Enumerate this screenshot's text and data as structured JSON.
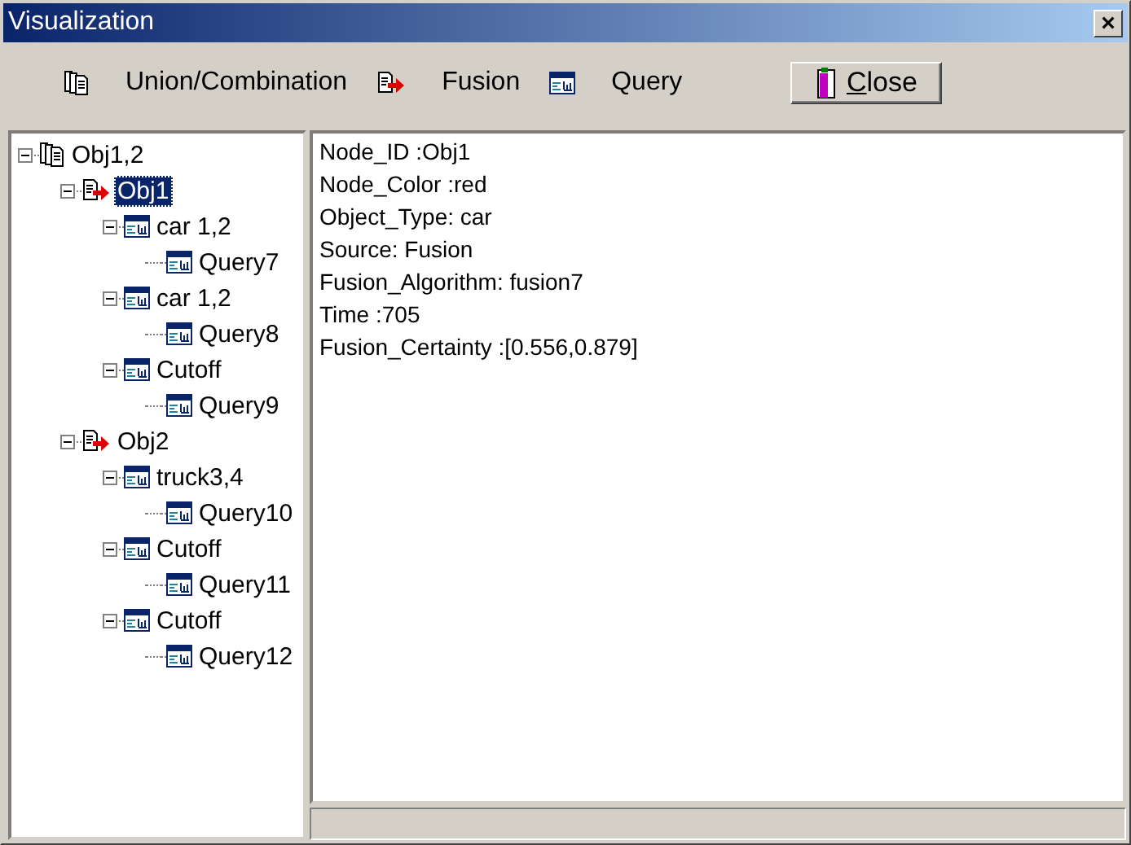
{
  "window": {
    "title": "Visualization",
    "close_glyph": "×"
  },
  "toolbar": {
    "legend": [
      {
        "kind": "union",
        "label": "Union/Combination"
      },
      {
        "kind": "fusion",
        "label": "Fusion"
      },
      {
        "kind": "query",
        "label": "Query"
      }
    ],
    "close_button": {
      "underlined": "C",
      "rest": "lose"
    }
  },
  "tree": [
    {
      "kind": "union",
      "label": "Obj1,2",
      "expanded": true,
      "selected": false,
      "children": [
        {
          "kind": "fusion",
          "label": "Obj1",
          "expanded": true,
          "selected": true,
          "children": [
            {
              "kind": "query",
              "label": "car 1,2",
              "expanded": true,
              "selected": false,
              "children": [
                {
                  "kind": "query",
                  "label": "Query7",
                  "selected": false
                }
              ]
            },
            {
              "kind": "query",
              "label": "car 1,2",
              "expanded": true,
              "selected": false,
              "children": [
                {
                  "kind": "query",
                  "label": "Query8",
                  "selected": false
                }
              ]
            },
            {
              "kind": "query",
              "label": "Cutoff",
              "expanded": true,
              "selected": false,
              "children": [
                {
                  "kind": "query",
                  "label": "Query9",
                  "selected": false
                }
              ]
            }
          ]
        },
        {
          "kind": "fusion",
          "label": "Obj2",
          "expanded": true,
          "selected": false,
          "children": [
            {
              "kind": "query",
              "label": "truck3,4",
              "expanded": true,
              "selected": false,
              "children": [
                {
                  "kind": "query",
                  "label": "Query10",
                  "selected": false
                }
              ]
            },
            {
              "kind": "query",
              "label": "Cutoff",
              "expanded": true,
              "selected": false,
              "children": [
                {
                  "kind": "query",
                  "label": "Query11",
                  "selected": false
                }
              ]
            },
            {
              "kind": "query",
              "label": "Cutoff",
              "expanded": true,
              "selected": false,
              "children": [
                {
                  "kind": "query",
                  "label": "Query12",
                  "selected": false
                }
              ]
            }
          ]
        }
      ]
    }
  ],
  "details": [
    "Node_ID :Obj1",
    "Node_Color :red",
    "Object_Type: car",
    "Source: Fusion",
    "Fusion_Algorithm: fusion7",
    "Time :705",
    "Fusion_Certainty :[0.556,0.879]"
  ]
}
